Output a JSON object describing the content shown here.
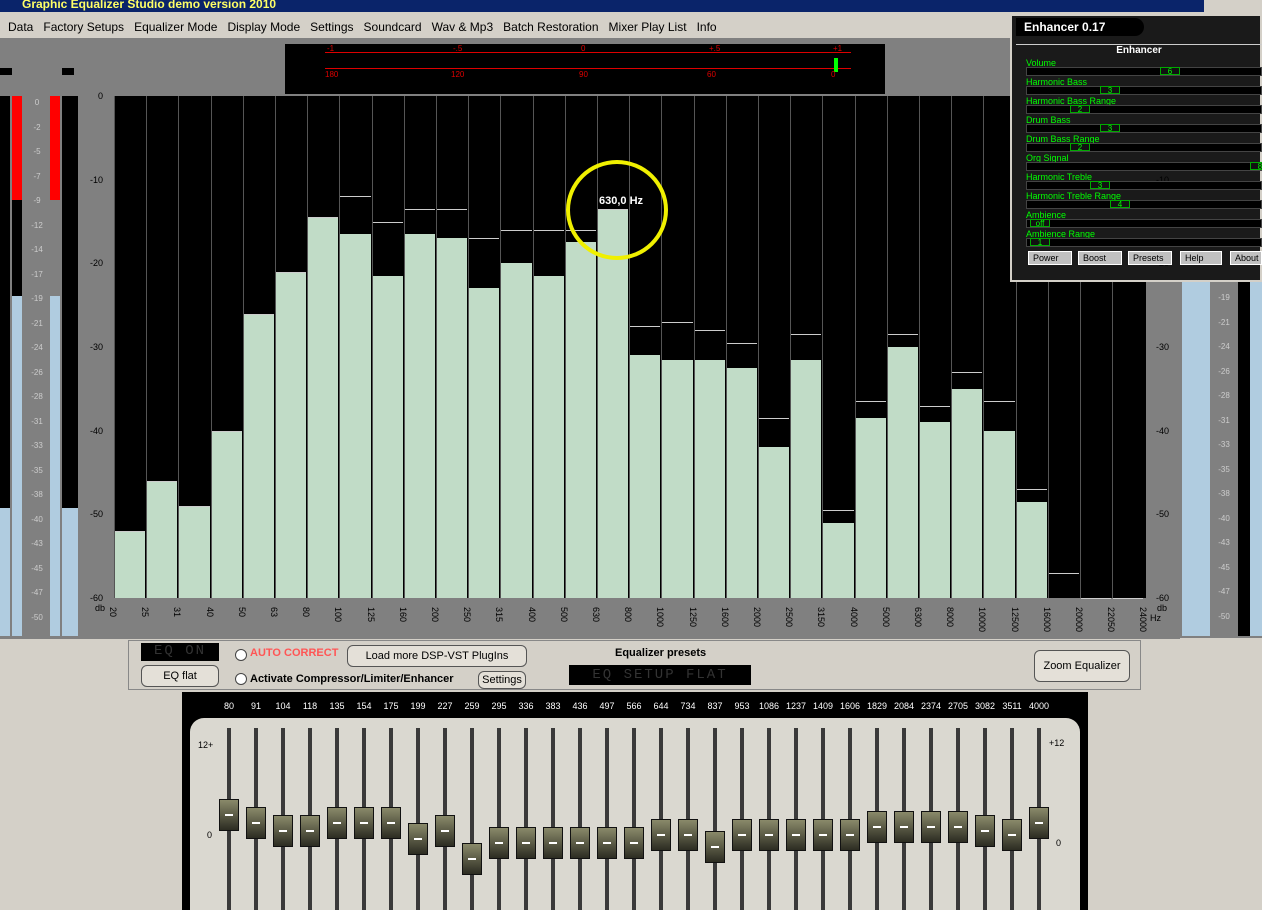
{
  "window": {
    "title": "Graphic Equalizer Studio demo version 2010"
  },
  "menu": [
    "Data",
    "Factory Setups",
    "Equalizer Mode",
    "Display Mode",
    "Settings",
    "Soundcard",
    "Wav & Mp3",
    "Batch Restoration",
    "Mixer Play List",
    "Info"
  ],
  "phase": {
    "top": [
      "-1",
      "-.5",
      "0",
      "+.5",
      "+1"
    ],
    "bottom": [
      "180",
      "120",
      "90",
      "60",
      "0"
    ]
  },
  "spectrum": {
    "y_labels": [
      "0",
      "-10",
      "-20",
      "-30",
      "-40",
      "-50",
      "-60"
    ],
    "y_unit": "db",
    "x_labels": [
      "20",
      "25",
      "31",
      "40",
      "50",
      "63",
      "80",
      "100",
      "125",
      "160",
      "200",
      "250",
      "315",
      "400",
      "500",
      "630",
      "800",
      "1000",
      "1250",
      "1600",
      "2000",
      "2500",
      "3150",
      "4000",
      "5000",
      "6300",
      "8000",
      "10000",
      "12500",
      "16000",
      "20000",
      "22050",
      "24000"
    ],
    "x_unit": "Hz",
    "bars_db": [
      -52,
      -46,
      -49,
      -40,
      -26,
      -21,
      -14.5,
      -16.5,
      -21.5,
      -16.5,
      -17,
      -23,
      -20,
      -21.5,
      -17.5,
      -13.5,
      -31,
      -31.5,
      -31.5,
      -32.5,
      -42,
      -31.5,
      -51,
      -38.5,
      -30,
      -39,
      -35,
      -40,
      -48.5,
      -60,
      -60,
      -60
    ],
    "peaks_db": [
      -52,
      -46,
      -49,
      -40,
      -26,
      -21,
      -14.5,
      -12,
      -15,
      -13.5,
      -13.5,
      -17,
      -16,
      -16,
      -16,
      -13.5,
      -27.5,
      -27,
      -28,
      -29.5,
      -38.5,
      -28.5,
      -49.5,
      -36.5,
      -28.5,
      -37,
      -33,
      -36.5,
      -47,
      -57,
      -60,
      -60
    ],
    "highlight": "630,0 Hz"
  },
  "vu_left": [
    "0",
    "-2",
    "-5",
    "-7",
    "-9",
    "-12",
    "-14",
    "-17",
    "-19",
    "-21",
    "-24",
    "-26",
    "-28",
    "-31",
    "-33",
    "-35",
    "-38",
    "-40",
    "-43",
    "-45",
    "-47",
    "-50"
  ],
  "vu_right": [
    "-19",
    "-21",
    "-24",
    "-26",
    "-28",
    "-31",
    "-33",
    "-35",
    "-38",
    "-40",
    "-43",
    "-45",
    "-47",
    "-50"
  ],
  "controls": {
    "eq_on_lcd": "EQ ON",
    "eq_flat": "EQ flat",
    "auto_correct": "AUTO CORRECT",
    "load_plugins": "Load more DSP-VST PlugIns",
    "activate_comp": "Activate Compressor/Limiter/Enhancer",
    "settings": "Settings",
    "presets_label": "Equalizer presets",
    "preset_lcd": "EQ SETUP FLAT",
    "zoom": "Zoom Equalizer"
  },
  "eq": {
    "freqs": [
      "80",
      "91",
      "104",
      "118",
      "135",
      "154",
      "175",
      "199",
      "227",
      "259",
      "295",
      "336",
      "383",
      "436",
      "497",
      "566",
      "644",
      "734",
      "837",
      "953",
      "1086",
      "1237",
      "1409",
      "1606",
      "1829",
      "2084",
      "2374",
      "2705",
      "3082",
      "3511",
      "4000"
    ],
    "levels": [
      0.55,
      0.45,
      0.35,
      0.35,
      0.45,
      0.45,
      0.45,
      0.25,
      0.35,
      0,
      0.2,
      0.2,
      0.2,
      0.2,
      0.2,
      0.2,
      0.3,
      0.3,
      0.15,
      0.3,
      0.3,
      0.3,
      0.3,
      0.3,
      0.4,
      0.4,
      0.4,
      0.4,
      0.35,
      0.3,
      0.45
    ],
    "top_left": "12+",
    "top_right": "+12",
    "mid_left": "0",
    "mid_right": "0"
  },
  "enhancer": {
    "title": "Enhancer 0.17",
    "header": "Enhancer",
    "params": [
      {
        "label": "Volume",
        "value": "6"
      },
      {
        "label": "Harmonic Bass",
        "value": "3"
      },
      {
        "label": "Harmonic Bass Range",
        "value": "2"
      },
      {
        "label": "Drum Bass",
        "value": "3"
      },
      {
        "label": "Drum Bass Range",
        "value": "2"
      },
      {
        "label": "Org Signal",
        "value": "8"
      },
      {
        "label": "Harmonic Treble",
        "value": "3"
      },
      {
        "label": "Harmonic Treble Range",
        "value": "4"
      },
      {
        "label": "Ambience",
        "value": "off"
      },
      {
        "label": "Ambience Range",
        "value": "1"
      }
    ],
    "buttons": [
      "Power",
      "Boost",
      "Presets",
      "Help",
      "About"
    ]
  }
}
